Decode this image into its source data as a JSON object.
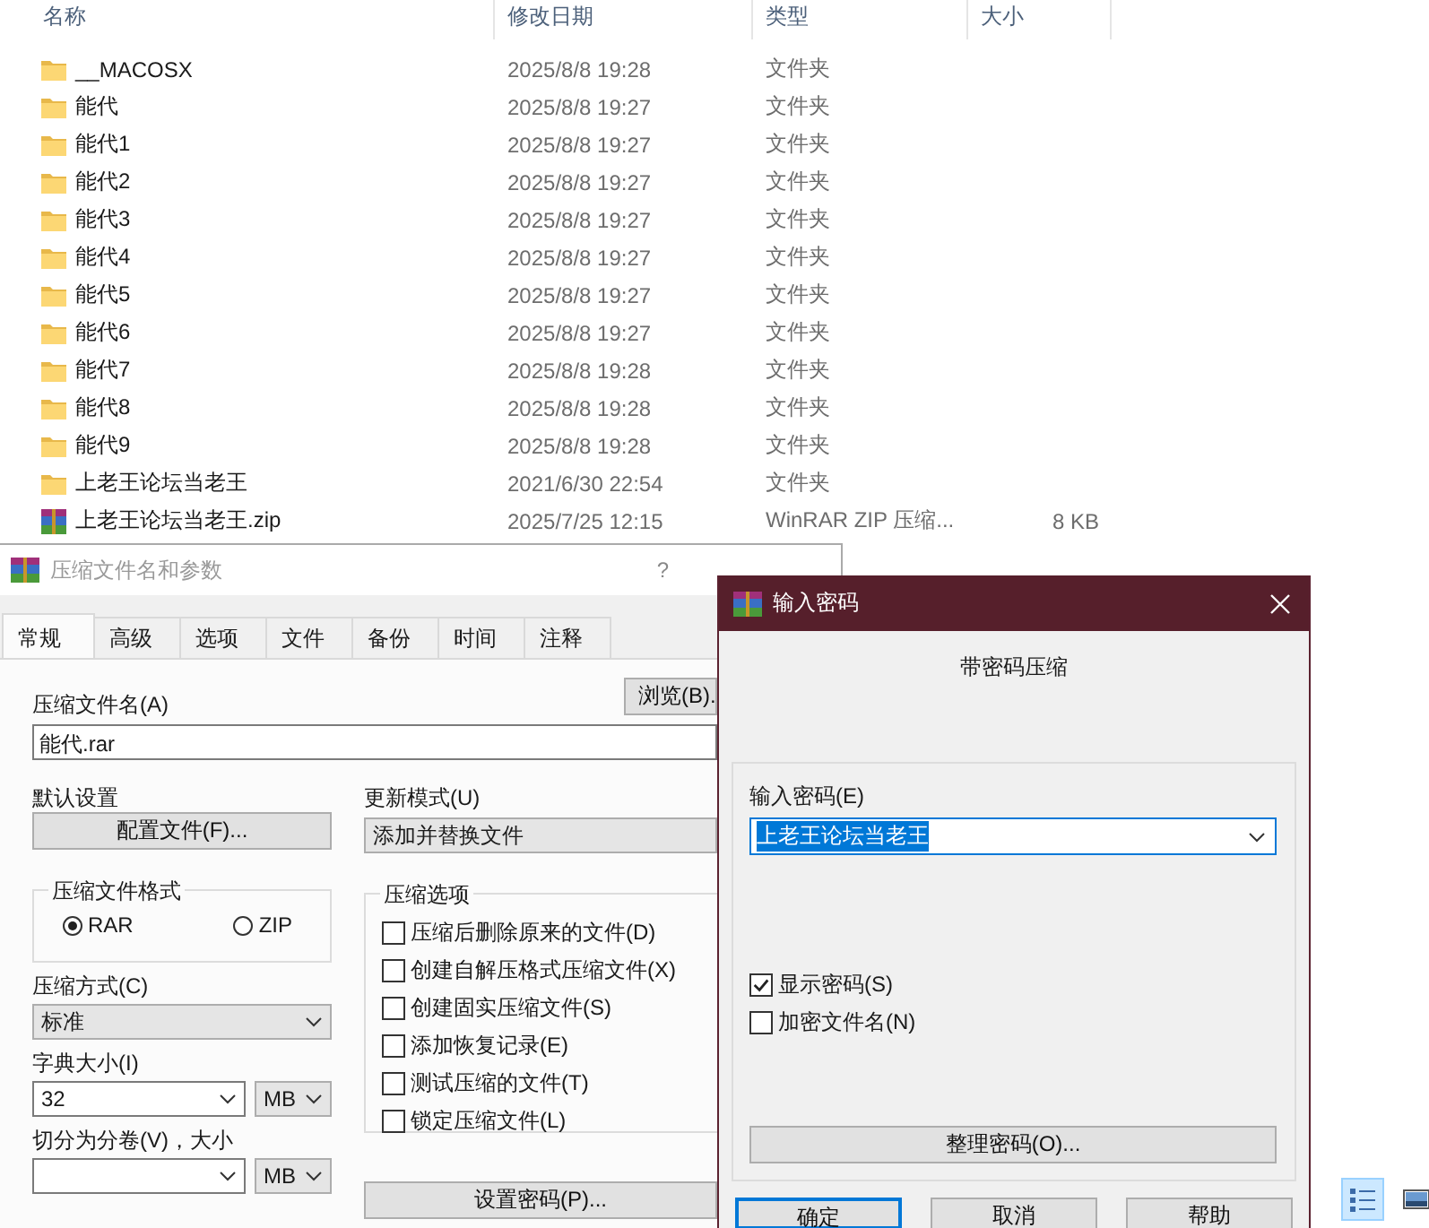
{
  "explorer": {
    "columns": [
      "名称",
      "修改日期",
      "类型",
      "大小"
    ],
    "rows": [
      {
        "kind": "folder",
        "name": "__MACOSX",
        "date": "2025/8/8 19:28",
        "type": "文件夹"
      },
      {
        "kind": "folder",
        "name": "能代",
        "date": "2025/8/8 19:27",
        "type": "文件夹"
      },
      {
        "kind": "folder",
        "name": "能代1",
        "date": "2025/8/8 19:27",
        "type": "文件夹"
      },
      {
        "kind": "folder",
        "name": "能代2",
        "date": "2025/8/8 19:27",
        "type": "文件夹"
      },
      {
        "kind": "folder",
        "name": "能代3",
        "date": "2025/8/8 19:27",
        "type": "文件夹"
      },
      {
        "kind": "folder",
        "name": "能代4",
        "date": "2025/8/8 19:27",
        "type": "文件夹"
      },
      {
        "kind": "folder",
        "name": "能代5",
        "date": "2025/8/8 19:27",
        "type": "文件夹"
      },
      {
        "kind": "folder",
        "name": "能代6",
        "date": "2025/8/8 19:27",
        "type": "文件夹"
      },
      {
        "kind": "folder",
        "name": "能代7",
        "date": "2025/8/8 19:28",
        "type": "文件夹"
      },
      {
        "kind": "folder",
        "name": "能代8",
        "date": "2025/8/8 19:28",
        "type": "文件夹"
      },
      {
        "kind": "folder",
        "name": "能代9",
        "date": "2025/8/8 19:28",
        "type": "文件夹"
      },
      {
        "kind": "folder",
        "name": "上老王论坛当老王",
        "date": "2021/6/30 22:54",
        "type": "文件夹"
      },
      {
        "kind": "archive",
        "name": "上老王论坛当老王.zip",
        "date": "2025/7/25 12:15",
        "type": "WinRAR ZIP 压缩...",
        "size": "8 KB"
      }
    ],
    "view_buttons": [
      {
        "kind": "details",
        "selected": true
      },
      {
        "kind": "preview",
        "selected": false
      }
    ]
  },
  "archive_dialog": {
    "title": "压缩文件名和参数",
    "help": "?",
    "tabs": [
      {
        "label": "常规",
        "selected": true
      },
      {
        "label": "高级",
        "selected": false
      },
      {
        "label": "选项",
        "selected": false
      },
      {
        "label": "文件",
        "selected": false
      },
      {
        "label": "备份",
        "selected": false
      },
      {
        "label": "时间",
        "selected": false
      },
      {
        "label": "注释",
        "selected": false
      }
    ],
    "archive_name_label": "压缩文件名(A)",
    "browse_button": "浏览(B).",
    "archive_name": "能代.rar",
    "profile_label": "默认设置",
    "profile_button": "配置文件(F)...",
    "update_mode_label": "更新模式(U)",
    "update_mode": "添加并替换文件",
    "format_group": {
      "title": "压缩文件格式",
      "options": [
        {
          "label": "RAR",
          "selected": true
        },
        {
          "label": "ZIP",
          "selected": false
        }
      ]
    },
    "method_label": "压缩方式(C)",
    "method": "标准",
    "dict_label": "字典大小(I)",
    "dict_size": "32",
    "dict_unit": "MB",
    "split_label": "切分为分卷(V)，大小",
    "split_unit": "MB",
    "options_group": {
      "title": "压缩选项",
      "items": [
        {
          "label": "压缩后删除原来的文件(D)",
          "checked": false
        },
        {
          "label": "创建自解压格式压缩文件(X)",
          "checked": false
        },
        {
          "label": "创建固实压缩文件(S)",
          "checked": false
        },
        {
          "label": "添加恢复记录(E)",
          "checked": false
        },
        {
          "label": "测试压缩的文件(T)",
          "checked": false
        },
        {
          "label": "锁定压缩文件(L)",
          "checked": false
        }
      ]
    },
    "password_button": "设置密码(P)..."
  },
  "password_dialog": {
    "title": "输入密码",
    "heading": "带密码压缩",
    "password_label": "输入密码(E)",
    "password": "上老王论坛当老王",
    "options": [
      {
        "label": "显示密码(S)",
        "checked": true
      },
      {
        "label": "加密文件名(N)",
        "checked": false
      }
    ],
    "organize_button": "整理密码(O)...",
    "buttons": [
      {
        "label": "确定",
        "selected": true
      },
      {
        "label": "取消",
        "selected": false
      },
      {
        "label": "帮助",
        "selected": false
      }
    ]
  }
}
